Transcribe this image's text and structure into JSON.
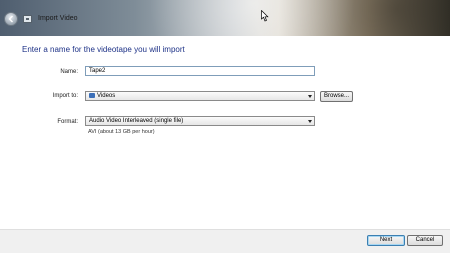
{
  "window": {
    "title": "Import Video"
  },
  "page": {
    "heading": "Enter a name for the videotape you will import"
  },
  "form": {
    "name_label": "Name:",
    "name_value": "Tape2",
    "import_label": "Import to:",
    "import_value": "Videos",
    "browse_label": "Browse...",
    "format_label": "Format:",
    "format_value": "Audio Video Interleaved (single file)",
    "format_hint": "AVI (about 13 GB per hour)"
  },
  "footer": {
    "next_label": "Next",
    "cancel_label": "Cancel"
  },
  "icons": {
    "back": "back-arrow-icon",
    "app": "import-video-icon",
    "folder": "videos-folder-icon",
    "cursor": "mouse-pointer-icon"
  },
  "colors": {
    "heading": "#1e3287",
    "accent": "#3c7fb1"
  }
}
